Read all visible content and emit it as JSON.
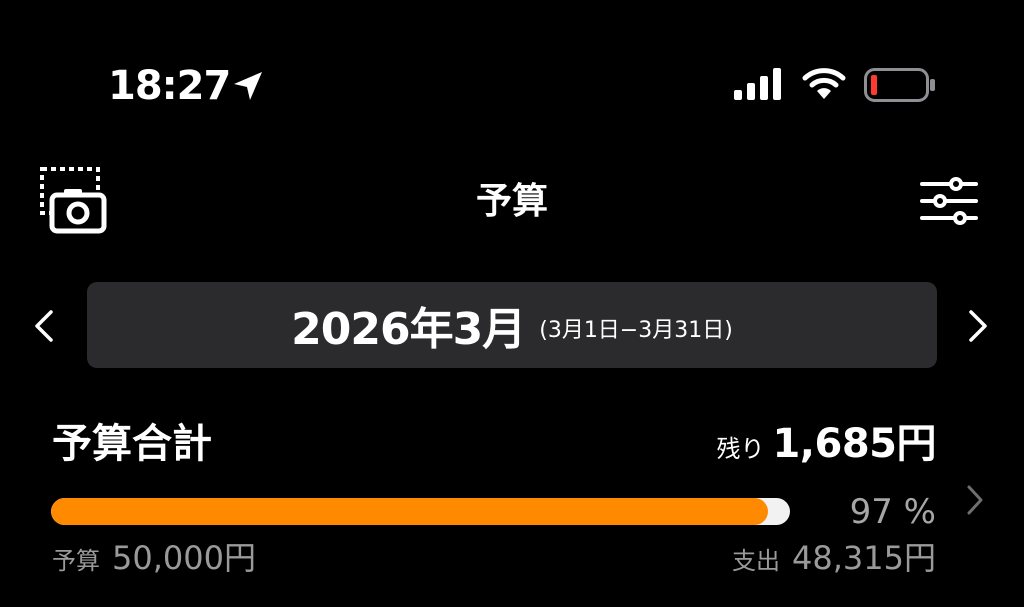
{
  "status_bar": {
    "time": "18:27",
    "icons": [
      "location-arrow-icon",
      "cellular-signal-icon",
      "wifi-icon",
      "battery-low-icon"
    ],
    "battery_color": "#ff3b30"
  },
  "header": {
    "title": "予算",
    "left_icon": "receipt-camera-icon",
    "right_icon": "sliders-icon"
  },
  "period": {
    "month": "2026年3月",
    "range": "(3月1日−3月31日)"
  },
  "total": {
    "label": "予算合計",
    "remaining_label": "残り",
    "remaining_amount": "1,685円",
    "percent": "97 %",
    "progress_fraction": 0.97,
    "budget_label": "予算",
    "budget_amount": "50,000円",
    "spent_label": "支出",
    "spent_amount": "48,315円"
  },
  "colors": {
    "accent": "#ff8a00",
    "background": "#000000",
    "card": "#2b2b2d"
  }
}
